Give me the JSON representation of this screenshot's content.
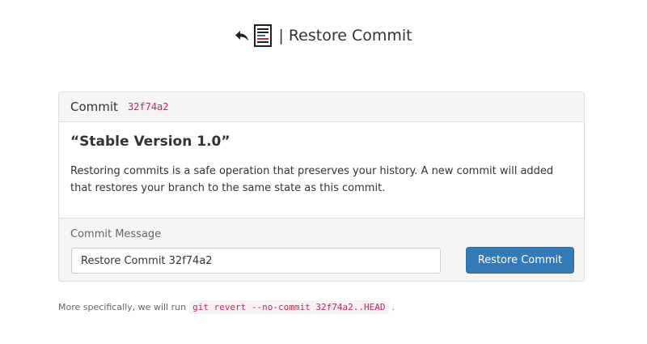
{
  "header": {
    "title": "| Restore Commit",
    "icons": [
      "undo-arrow-icon",
      "document-icon"
    ]
  },
  "panel": {
    "heading_label": "Commit",
    "commit_hash": "32f74a2",
    "commit_title": "“Stable Version 1.0”",
    "description": "Restoring commits is a safe operation that preserves your history. A new commit will added that restores your branch to the same state as this commit.",
    "footer": {
      "message_label": "Commit Message",
      "message_value": "Restore Commit 32f74a2",
      "button_label": "Restore Commit"
    }
  },
  "note": {
    "prefix": "More specifically, we will run",
    "command": "git revert --no-commit 32f74a2..HEAD",
    "suffix": "."
  },
  "colors": {
    "primary_button": "#337ab7",
    "code_text": "#c7254e",
    "code_bg": "#f9f2f4",
    "panel_heading_bg": "#f5f5f5"
  }
}
